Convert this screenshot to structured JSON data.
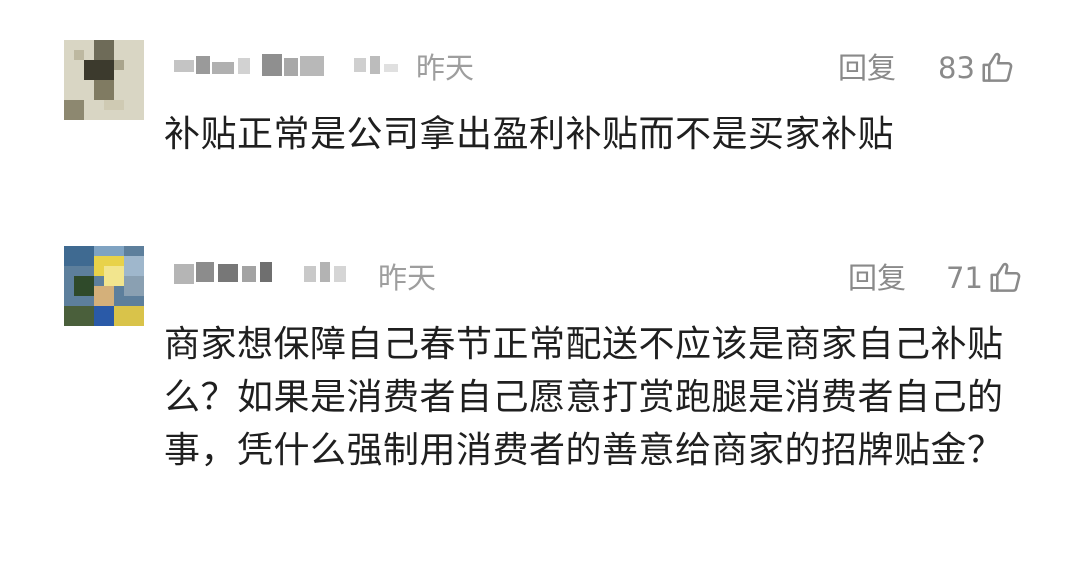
{
  "comments": [
    {
      "time": "昨天",
      "reply_label": "回复",
      "like_count": "83",
      "text": "补贴正常是公司拿出盈利补贴而不是买家补贴"
    },
    {
      "time": "昨天",
      "reply_label": "回复",
      "like_count": "71",
      "text": "商家想保障自己春节正常配送不应该是商家自己补贴么？如果是消费者自己愿意打赏跑腿是消费者自己的事，凭什么强制用消费者的善意给商家的招牌贴金？"
    }
  ],
  "icons": {
    "like": "thumbs-up-icon"
  },
  "colors": {
    "background": "#ffffff",
    "text_primary": "#1f1f1f",
    "text_secondary": "#8a8a8a"
  }
}
